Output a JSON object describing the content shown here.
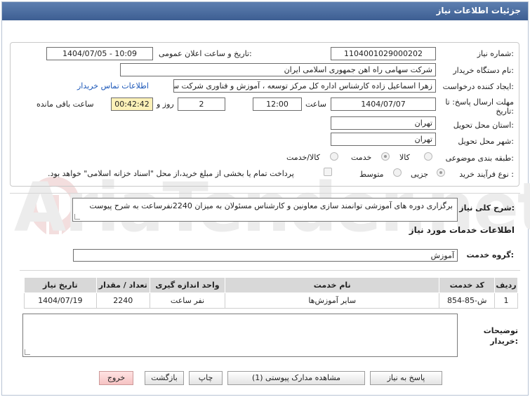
{
  "window": {
    "title": "جزئیات اطلاعات نیاز"
  },
  "fields": {
    "need_number_label": "شماره نیاز:",
    "need_number": "1104001029000202",
    "announce_label": "تاریخ و ساعت اعلان عمومی:",
    "announce_value": "1404/07/05 - 10:09",
    "buyer_label": "نام دستگاه خریدار:",
    "buyer_value": "شرکت سهامی راه اهن جمهوری اسلامی ایران",
    "creator_label": "ایجاد کننده درخواست:",
    "creator_value": "زهرا اسماعیل زاده کارشناس اداره کل مرکز توسعه ، آموزش و فناوری شرکت سهامی راه اهن",
    "contact_link": "اطلاعات تماس خریدار",
    "deadline_label_1": "مهلت ارسال پاسخ: تا",
    "deadline_label_2": "تاریخ:",
    "deadline_date": "1404/07/07",
    "time_label": "ساعت",
    "deadline_time": "12:00",
    "days_value": "2",
    "days_label": "روز و",
    "remaining_value": "00:42:42",
    "remaining_label": "ساعت باقی مانده",
    "province_label": "استان محل تحویل:",
    "province_value": "تهران",
    "city_label": "شهر محل تحویل:",
    "city_value": "تهران",
    "category_label": "طبقه بندی موضوعی:",
    "category_options": [
      "کالا",
      "خدمت",
      "کالا/خدمت"
    ],
    "category_selected": "خدمت",
    "process_label": "نوع فرآیند خرید :",
    "process_options": [
      "جزیی",
      "متوسط"
    ],
    "process_selected": "جزیی",
    "payment_note": "پرداخت تمام یا بخشی از مبلغ خرید،از محل \"اسناد خزانه اسلامی\" خواهد بود."
  },
  "description": {
    "label": "شرح کلی نیاز:",
    "value": "برگزاری دوره های آموزشی توانمند سازی معاونین و کارشناس مسئولان  به میزان 2240نفرساعت به شرح پیوست"
  },
  "services": {
    "heading": "اطلاعات خدمات مورد نیاز",
    "group_label": "گروه خدمت:",
    "group_value": "آموزش",
    "columns": [
      "ردیف",
      "کد خدمت",
      "نام خدمت",
      "واحد اندازه گیری",
      "تعداد / مقدار",
      "تاریخ نیاز"
    ],
    "rows": [
      [
        "1",
        "ش-85-854",
        "سایر آموزش‌ها",
        "نفر ساعت",
        "2240",
        "1404/07/19"
      ]
    ]
  },
  "buyer_notes": {
    "label_1": "توضیحات",
    "label_2": "خریدار:",
    "value": ""
  },
  "buttons": {
    "reply": "پاسخ به نیاز",
    "attachments": "مشاهده مدارک پیوستی (1)",
    "print": "چاپ",
    "back": "بازگشت",
    "exit": "خروج"
  },
  "watermark": "AriaTender.net"
}
